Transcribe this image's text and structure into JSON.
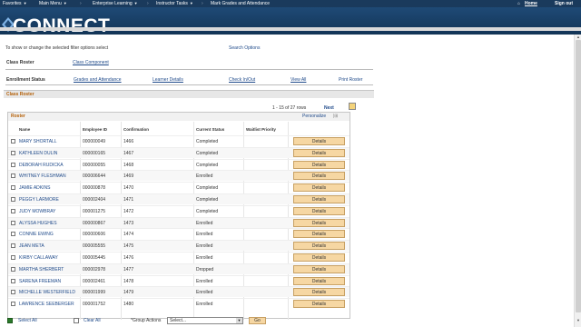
{
  "topnav": {
    "favorites": "Favorites",
    "main_menu": "Main Menu",
    "enterprise_learning": "Enterprise Learning",
    "instructor_tasks": "Instructor Tasks",
    "mark_grades": "Mark Grades and Attendance",
    "home": "Home",
    "signout": "Sign out"
  },
  "banner": {
    "brand": "CONNECT"
  },
  "filter": {
    "text": "To show or change the selected filter options select",
    "search_options": "Search Options"
  },
  "nav1": {
    "label": "Class Roster",
    "link": "Class Component"
  },
  "nav2": {
    "label": "Enrollment Status",
    "links": [
      "Grades and Attendance",
      "Learner Details",
      "Check In/Out",
      "View All",
      "Print Roster"
    ]
  },
  "section": {
    "title": "Class Roster"
  },
  "pager": {
    "range": "1 - 15 of 27 rows",
    "next": "Next"
  },
  "roster": {
    "title": "Roster",
    "personalize": "Personalize",
    "columns": [
      "Name",
      "Employee ID",
      "Confirmation",
      "Current Status",
      "Waitlist Priority"
    ],
    "details_label": "Details",
    "rows": [
      {
        "name": "MARY SHORTALL",
        "id": "000000049",
        "conf": "1466",
        "status": "Completed"
      },
      {
        "name": "KATHLEEN DULIN",
        "id": "000000165",
        "conf": "1467",
        "status": "Completed"
      },
      {
        "name": "DEBORAH RUDICKA",
        "id": "000000055",
        "conf": "1468",
        "status": "Completed"
      },
      {
        "name": "WHITNEY FLESHMAN",
        "id": "000006644",
        "conf": "1469",
        "status": "Enrolled"
      },
      {
        "name": "JAMIE ADKINS",
        "id": "000000878",
        "conf": "1470",
        "status": "Completed"
      },
      {
        "name": "PEGGY LARMORE",
        "id": "000002404",
        "conf": "1471",
        "status": "Completed"
      },
      {
        "name": "JUDY MOWBRAY",
        "id": "000001275",
        "conf": "1472",
        "status": "Completed"
      },
      {
        "name": "ALYSSA HUGHES",
        "id": "000000867",
        "conf": "1473",
        "status": "Enrolled"
      },
      {
        "name": "CONNIE EWING",
        "id": "000000606",
        "conf": "1474",
        "status": "Enrolled"
      },
      {
        "name": "JEAN META",
        "id": "000005555",
        "conf": "1475",
        "status": "Enrolled"
      },
      {
        "name": "KIRBY CALLAWAY",
        "id": "000005445",
        "conf": "1476",
        "status": "Enrolled"
      },
      {
        "name": "MARTHA SHERBERT",
        "id": "000002978",
        "conf": "1477",
        "status": "Dropped"
      },
      {
        "name": "SARENA FREEMAN",
        "id": "000002461",
        "conf": "1478",
        "status": "Enrolled"
      },
      {
        "name": "MICHELLE WESTERFIELD",
        "id": "000001999",
        "conf": "1479",
        "status": "Enrolled"
      },
      {
        "name": "LAWRENCE SEEBERGER",
        "id": "000001752",
        "conf": "1480",
        "status": "Enrolled"
      }
    ]
  },
  "footer": {
    "select_all": "Select All",
    "clear_all": "Clear All",
    "group_actions": "*Group Actions",
    "group_select": "Select...",
    "go": "Go"
  },
  "colors": {
    "nav": "#1a3a5c",
    "accent": "#b45f06",
    "link": "#1f4a8a",
    "button": "#f6d7a3"
  },
  "icons": [
    "home-icon",
    "grid-view-icon",
    "checkbox-icon",
    "dropdown-arrow-icon",
    "caret-down-icon"
  ]
}
